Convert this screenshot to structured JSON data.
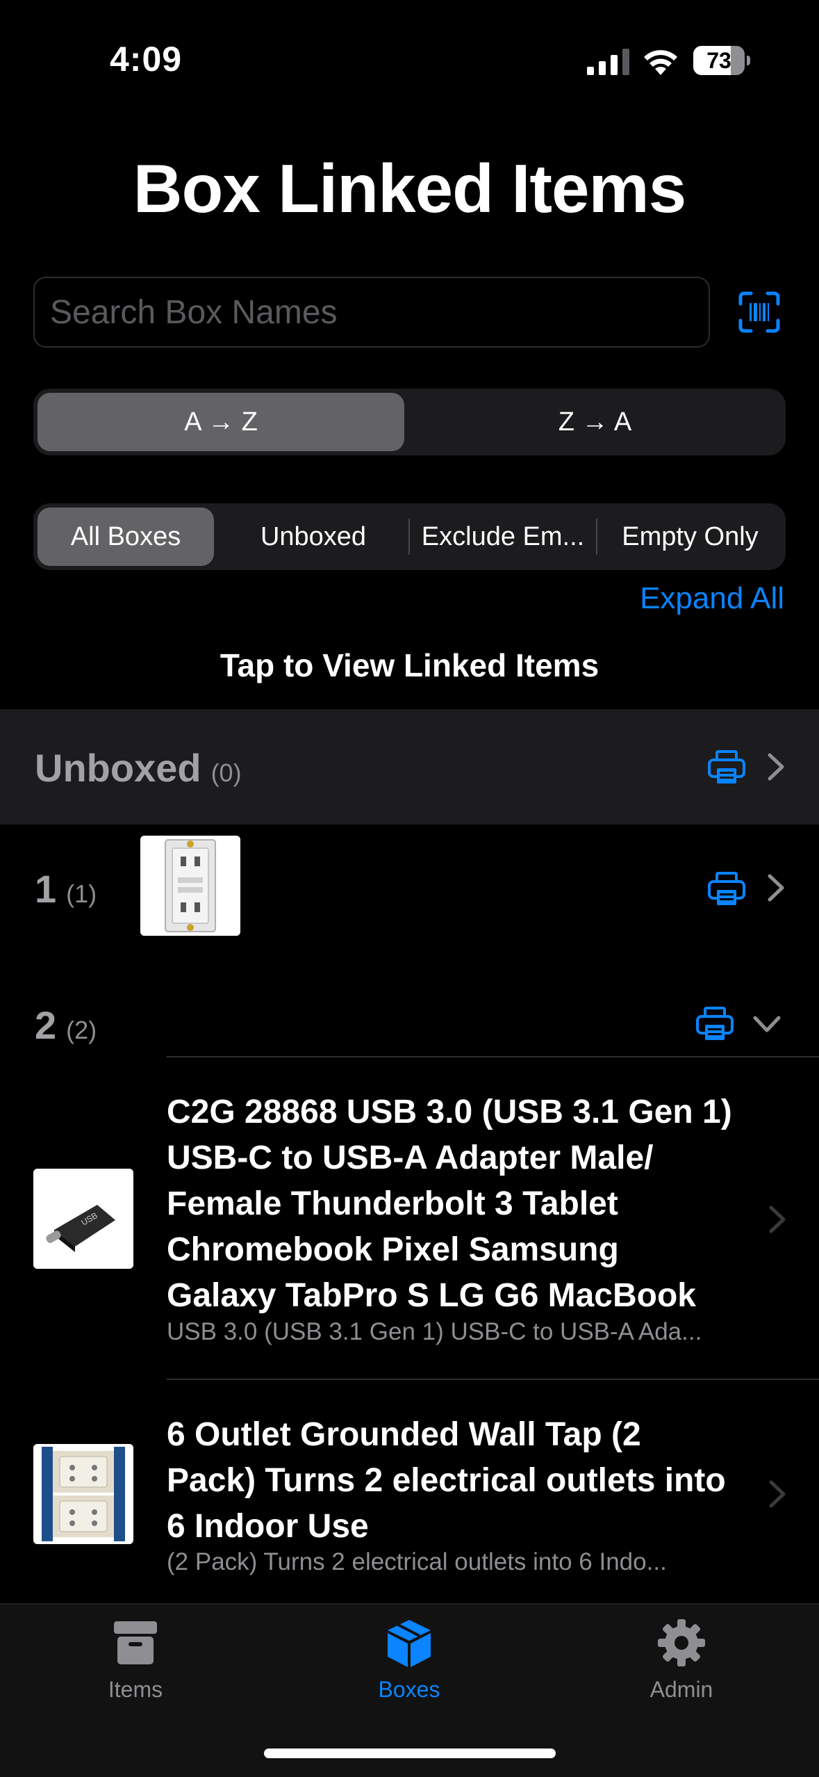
{
  "status": {
    "time": "4:09",
    "battery": "73",
    "battery_level": 0.73
  },
  "title": "Box Linked Items",
  "search": {
    "placeholder": "Search Box Names",
    "value": ""
  },
  "sort": {
    "options": [
      "A → Z",
      "Z → A"
    ],
    "selected": "A → Z"
  },
  "filter": {
    "options": [
      "All Boxes",
      "Unboxed",
      "Exclude Em...",
      "Empty Only"
    ],
    "selected": "All Boxes"
  },
  "expand_all_label": "Expand All",
  "hint": "Tap to View Linked Items",
  "boxes": {
    "unboxed": {
      "name": "Unboxed",
      "count": "(0)"
    },
    "box1": {
      "name": "1",
      "count": "(1)"
    },
    "box2": {
      "name": "2",
      "count": "(2)"
    }
  },
  "items": [
    {
      "title": "C2G 28868 USB 3.0 (USB 3.1 Gen 1) USB-C to USB-A Adapter Male/ Female Thunderbolt 3  Tablet Chromebook Pixel  Samsung Galaxy TabPro S  LG G6  MacBook",
      "subtitle": "USB 3.0 (USB 3.1 Gen 1) USB-C to USB-A Ada..."
    },
    {
      "title": "6 Outlet Grounded Wall Tap (2 Pack) Turns 2 electrical outlets into 6 Indoor Use",
      "subtitle": "(2 Pack) Turns 2 electrical outlets into 6 Indo..."
    }
  ],
  "tabs": [
    {
      "label": "Items",
      "icon": "archive-box-icon"
    },
    {
      "label": "Boxes",
      "icon": "cube-box-icon"
    },
    {
      "label": "Admin",
      "icon": "gear-icon"
    }
  ],
  "colors": {
    "accent": "#0a84ff",
    "background": "#000000",
    "segment_bg": "#1c1c1e"
  }
}
